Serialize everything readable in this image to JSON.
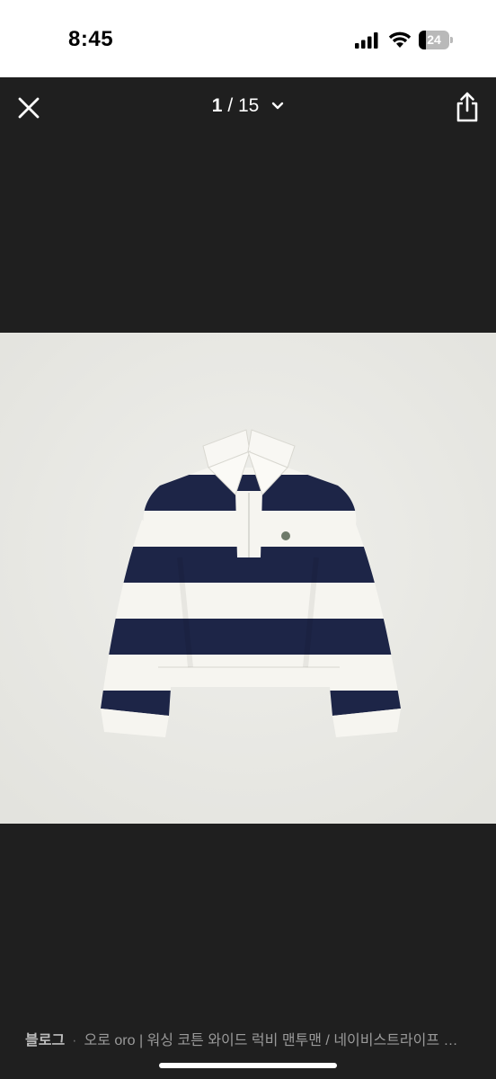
{
  "status_bar": {
    "time": "8:45",
    "battery_level": "24",
    "icons": [
      "cellular-signal-icon",
      "wifi-icon",
      "battery-icon"
    ]
  },
  "viewer": {
    "current_index": "1",
    "separator": "/",
    "total": "15",
    "icons": [
      "close-icon",
      "chevron-down-icon",
      "share-icon"
    ]
  },
  "photo": {
    "subject": "navy and white striped rugby sweatshirt",
    "colors": {
      "background": "#eaeae6",
      "navy": "#1d2547",
      "white": "#f6f5f0"
    }
  },
  "caption": {
    "source": "블로그",
    "title": "오로 oro | 워싱 코튼 와이드 럭비 맨투맨 / 네이비스트라이프 …"
  }
}
